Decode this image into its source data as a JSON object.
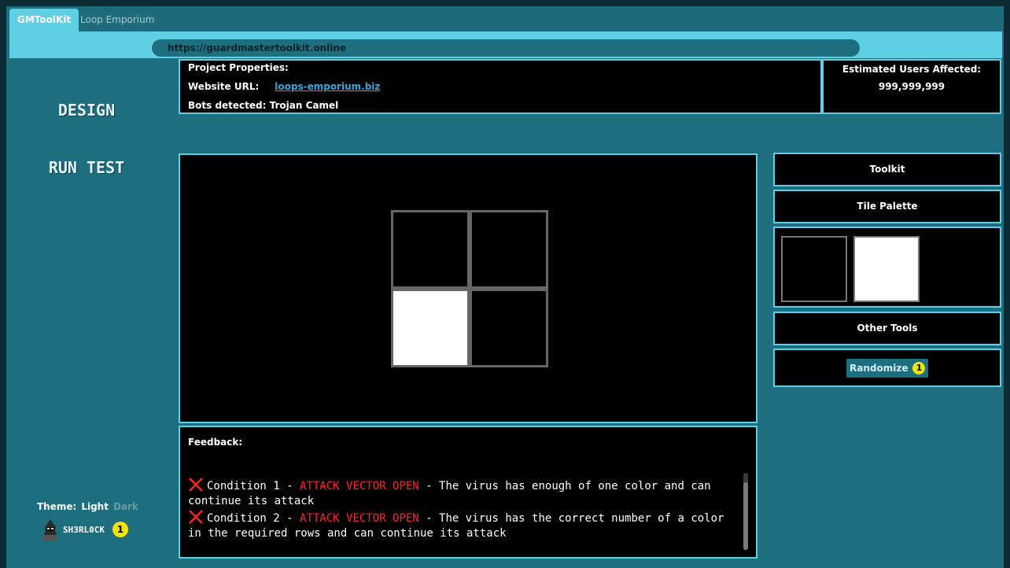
{
  "tabs": [
    {
      "label": "GMToolKit",
      "active": true
    },
    {
      "label": "Loop Emporium",
      "active": false
    }
  ],
  "address_bar": {
    "url": "https://guardmastertoolkit.online"
  },
  "sidebar": {
    "nav": [
      {
        "label": "DESIGN"
      },
      {
        "label": "RUN TEST"
      }
    ],
    "theme": {
      "label": "Theme:",
      "light": "Light",
      "dark": "Dark",
      "selected": "Light"
    },
    "user": {
      "name": "SH3RL0CK",
      "notifications": "1"
    }
  },
  "project": {
    "heading": "Project Properties:",
    "url_label": "Website URL:",
    "url_value": "loops-emporium.biz",
    "bots_label": "Bots detected:",
    "bots_value": "Trojan Camel"
  },
  "estimate": {
    "label": "Estimated Users Affected:",
    "value": "999,999,999"
  },
  "canvas": {
    "tiles": [
      {
        "color": "#000000"
      },
      {
        "color": "#000000"
      },
      {
        "color": "#ffffff"
      },
      {
        "color": "#000000"
      }
    ]
  },
  "feedback": {
    "heading": "Feedback:",
    "items": [
      {
        "status": "fail",
        "name": "Condition 1 -",
        "alert": "ATTACK VECTOR OPEN",
        "text": "- The virus has enough of one color and can continue its attack"
      },
      {
        "status": "fail",
        "name": "Condition 2 -",
        "alert": "ATTACK VECTOR OPEN",
        "text": "- The virus has the correct number of a color in the required rows and can continue its attack"
      }
    ]
  },
  "tools": {
    "toolkit_label": "Toolkit",
    "tile_palette_label": "Tile Palette",
    "palette": [
      {
        "color": "#000000"
      },
      {
        "color": "#ffffff"
      }
    ],
    "other_tools_label": "Other Tools",
    "randomize_label": "Randomize",
    "randomize_badge": "1"
  },
  "colors": {
    "accent": "#5fd0e4",
    "panel": "#1d6f80",
    "alert": "#ff2525",
    "badge": "#f4e400",
    "link": "#3aa6d8"
  }
}
